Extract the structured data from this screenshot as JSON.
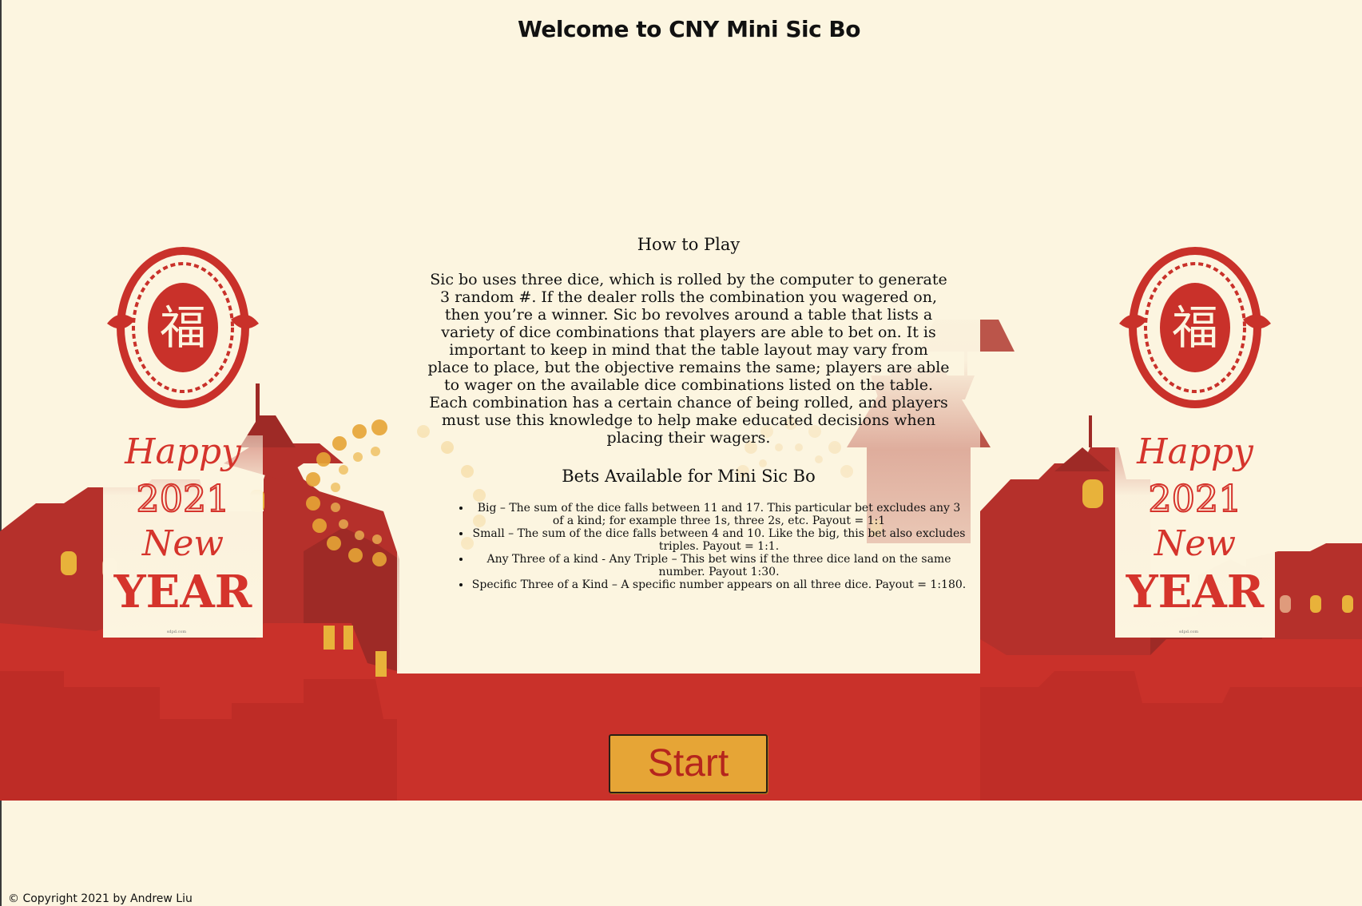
{
  "header": {
    "title": "Welcome to CNY Mini Sic Bo"
  },
  "how_to_play": {
    "heading": "How to Play",
    "body": "Sic bo uses three dice, which is rolled by the computer to generate 3 random #. If the dealer rolls the combination you wagered on, then you’re a winner. Sic bo revolves around a table that lists a variety of dice combinations that players are able to bet on. It is important to keep in mind that the table layout may vary from place to place, but the objective remains the same; players are able to wager on the available dice combinations listed on the table. Each combination has a certain chance of being rolled, and players must use this knowledge to help make educated decisions when placing their wagers."
  },
  "bets": {
    "heading": "Bets Available for Mini Sic Bo",
    "items": [
      "Big – The sum of the dice falls between 11 and 17. This particular bet excludes any 3 of a kind; for example three 1s, three 2s, etc. Payout = 1:1",
      "Small – The sum of the dice falls between 4 and 10. Like the big, this bet also excludes triples. Payout = 1:1.",
      "Any Three of a kind - Any Triple – This bet wins if the three dice land on the same number. Payout 1:30.",
      "Specific Three of a Kind – A specific number appears on all three dice. Payout = 1:180."
    ]
  },
  "posters": {
    "line1": "Happy",
    "line2": "2021",
    "line3": "New",
    "line4": "YEAR",
    "credit": "sdpd.com"
  },
  "start_button": {
    "label": "Start"
  },
  "footer": {
    "copyright": "© Copyright 2021 by Andrew Liu"
  },
  "colors": {
    "background": "#fcf5e0",
    "skyline_red": "#c9312a",
    "skyline_dark": "#a22a26",
    "accent_gold": "#e6a536",
    "button_text": "#b5251d"
  }
}
